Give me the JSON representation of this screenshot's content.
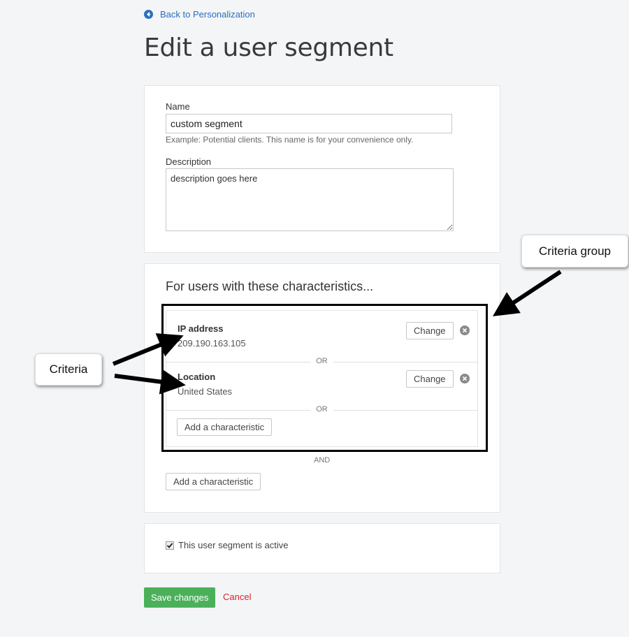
{
  "nav": {
    "back_label": "Back to Personalization",
    "back_icon": "arrow-left-circle-icon"
  },
  "page": {
    "title": "Edit a user segment"
  },
  "form": {
    "name_label": "Name",
    "name_value": "custom segment",
    "name_hint": "Example: Potential clients. This name is for your convenience only.",
    "description_label": "Description",
    "description_value": "description goes here"
  },
  "criteria": {
    "heading": "For users with these characteristics...",
    "items": [
      {
        "name": "IP address",
        "value": "209.190.163.105",
        "change_label": "Change"
      },
      {
        "name": "Location",
        "value": "United States",
        "change_label": "Change"
      }
    ],
    "or_label": "OR",
    "and_label": "AND",
    "add_in_group_label": "Add a characteristic",
    "add_group_label": "Add a characteristic"
  },
  "active": {
    "label": "This user segment is active",
    "checked": true
  },
  "actions": {
    "save_label": "Save changes",
    "cancel_label": "Cancel"
  },
  "annotations": {
    "group_callout": "Criteria group",
    "criteria_callout": "Criteria"
  },
  "colors": {
    "link": "#2a6fc0",
    "save": "#4cb05b",
    "cancel": "#d9232b"
  }
}
